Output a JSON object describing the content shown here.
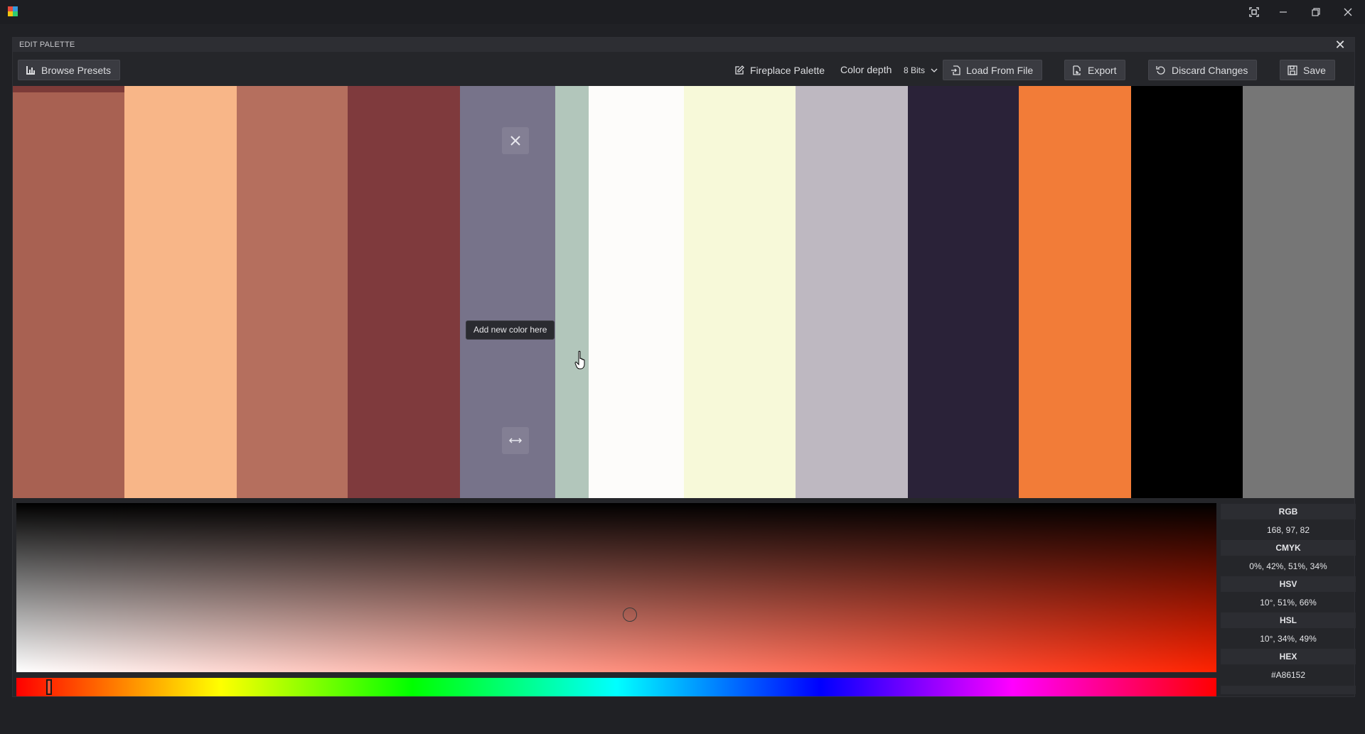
{
  "dialog": {
    "title": "EDIT PALETTE"
  },
  "toolbar": {
    "browse_presets": "Browse Presets",
    "palette_name": "Fireplace Palette",
    "color_depth_label": "Color depth",
    "color_depth_value": "8 Bits",
    "load_from_file": "Load From File",
    "export": "Export",
    "discard_changes": "Discard Changes",
    "save": "Save"
  },
  "palette": {
    "swatches": [
      {
        "color": "#A86152",
        "selected": true
      },
      {
        "color": "#F8B688"
      },
      {
        "color": "#B56F5E"
      },
      {
        "color": "#7F3A3D"
      },
      {
        "color": "#77738A",
        "hovered": true
      },
      {
        "color": "#B2C6BB"
      },
      {
        "color": "#FDFCFA"
      },
      {
        "color": "#F7F9D9"
      },
      {
        "color": "#BEB8C1"
      },
      {
        "color": "#2A2238"
      },
      {
        "color": "#F27C38"
      },
      {
        "color": "#000000"
      },
      {
        "color": "#767676"
      }
    ],
    "tooltip": "Add new color here",
    "hover_icons": [
      "close-icon",
      "swap-horizontal-icon"
    ]
  },
  "picker": {
    "selected_color": "#A86152",
    "hue_degrees": 10
  },
  "color_values": {
    "rgb_label": "RGB",
    "rgb": "168, 97, 82",
    "cmyk_label": "CMYK",
    "cmyk": "0%, 42%, 51%, 34%",
    "hsv_label": "HSV",
    "hsv": "10°, 51%, 66%",
    "hsl_label": "HSL",
    "hsl": "10°, 34%, 49%",
    "hex_label": "HEX",
    "hex": "#A86152"
  }
}
